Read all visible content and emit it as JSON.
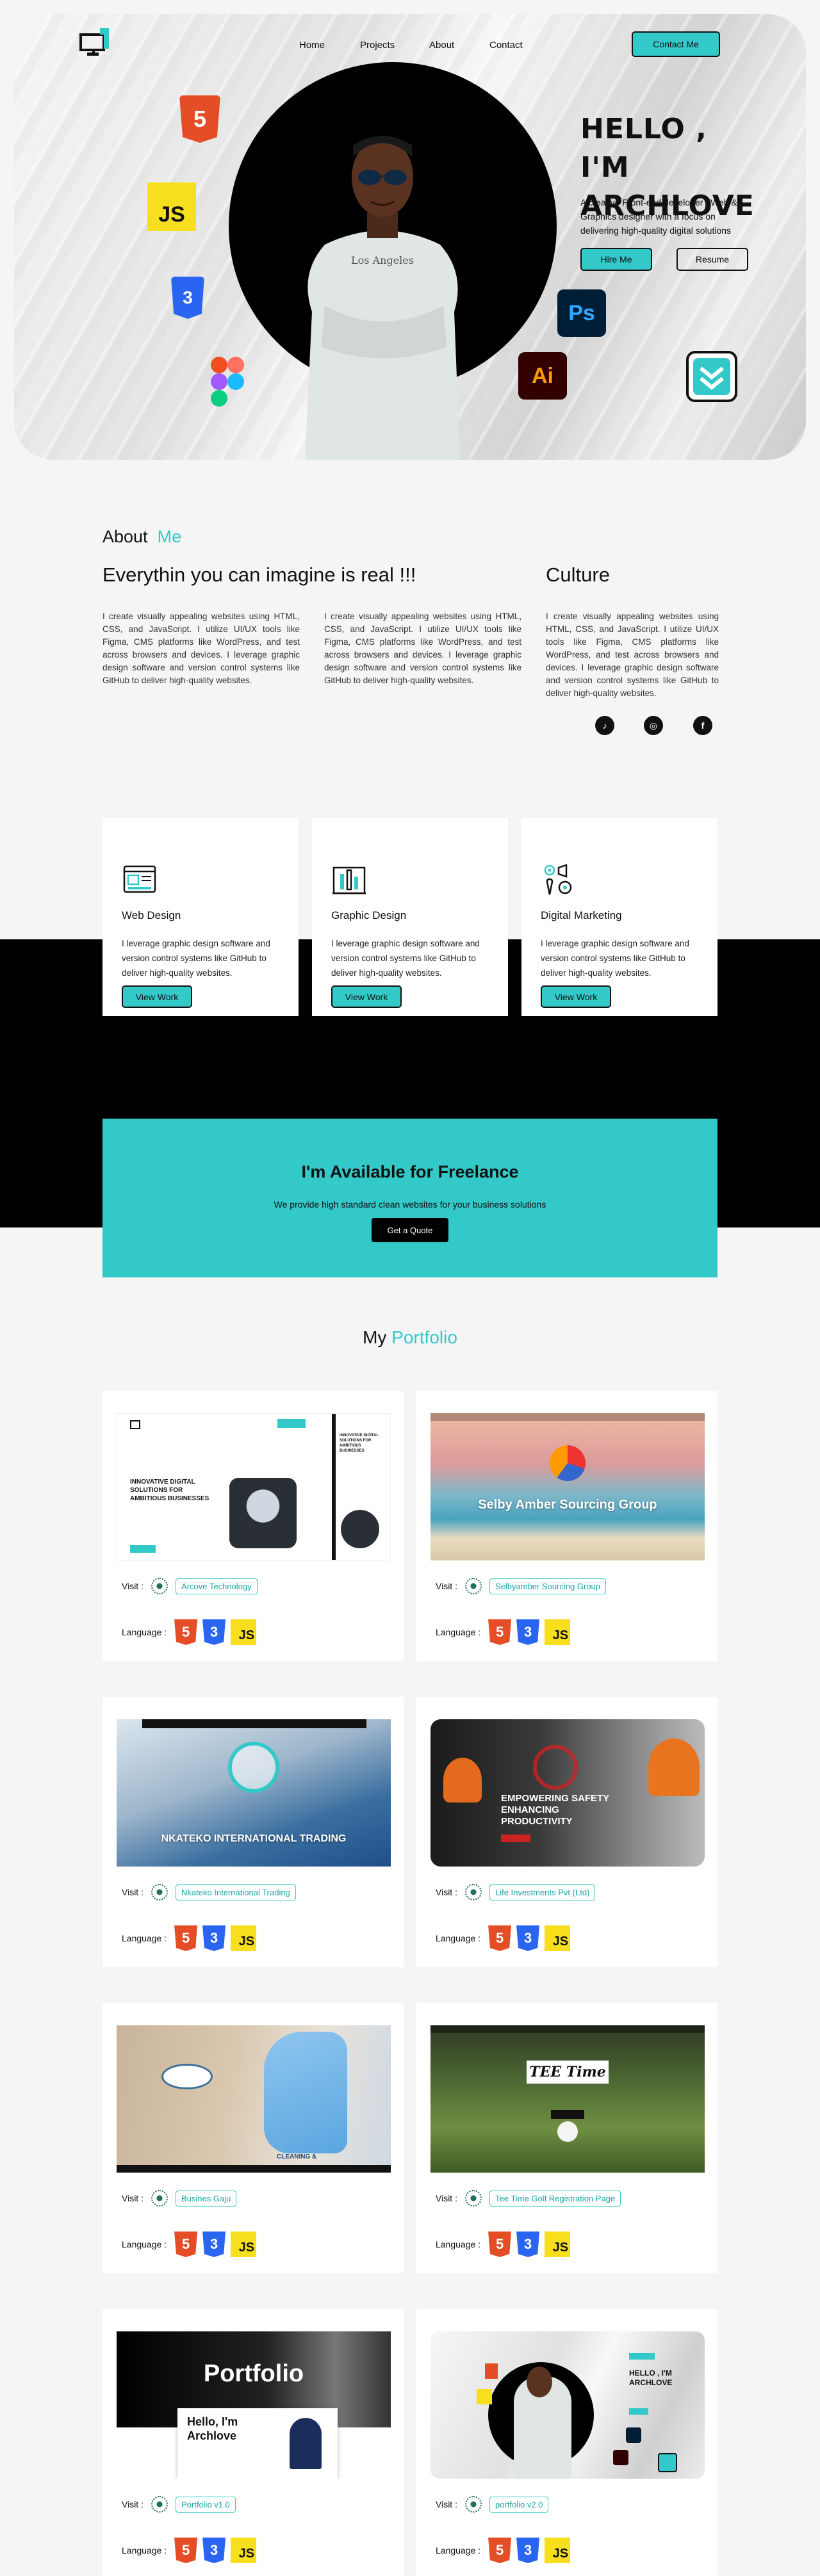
{
  "nav": {
    "items": [
      "Home",
      "Projects",
      "About",
      "Contact"
    ],
    "cta": "Contact Me"
  },
  "hero": {
    "line1": "HELLO ,",
    "line2": "I'M ARCHLOVE",
    "description": "A creative Front-end developer , Web & Graphics designer with a focus on delivering high-quality digital solutions",
    "primary_button": "Hire Me",
    "secondary_button": "Resume",
    "shirt_text": "Los Angeles",
    "tech_icons": {
      "html": "5",
      "js": "JS",
      "css": "3",
      "ps": "Ps",
      "ai": "Ai"
    }
  },
  "about": {
    "heading_prefix": "About",
    "heading_accent": "Me",
    "tagline": "Everythin you can imagine is real !!!",
    "culture_title": "Culture",
    "paragraph": "I create visually appealing websites using HTML, CSS, and JavaScript. I utilize UI/UX tools like Figma, CMS platforms like WordPress, and test across browsers and devices. I leverage graphic design software and version control systems like GitHub to deliver high-quality websites.",
    "social_icons": [
      "tiktok-icon",
      "instagram-icon",
      "facebook-icon"
    ]
  },
  "services": [
    {
      "title": "Web Design",
      "description": "I leverage graphic design software and version control systems like GitHub to deliver high-quality websites.",
      "button": "View Work"
    },
    {
      "title": "Graphic Design",
      "description": "I leverage graphic design software and version control systems like GitHub to deliver high-quality websites.",
      "button": "View Work"
    },
    {
      "title": "Digital Marketing",
      "description": "I leverage graphic design software and version control systems like GitHub to deliver high-quality websites.",
      "button": "View Work"
    }
  ],
  "freelance": {
    "title": "I'm Available for Freelance",
    "subtitle": "We provide high standard clean websites for your business solutions",
    "button": "Get a Quote"
  },
  "portfolio": {
    "heading_prefix": "My",
    "heading_accent": "Portfolio",
    "visit_label": "Visit :",
    "language_label": "Language :",
    "projects": [
      {
        "name": "Arcove Technology",
        "preview_title": "INNOVATIVE DIGITAL SOLUTIONS FOR AMBITIOUS BUSINESSES"
      },
      {
        "name": "Selbyamber Sourcing Group",
        "preview_title": "Selby Amber Sourcing Group"
      },
      {
        "name": "Nkateko International Trading",
        "preview_title": "NKATEKO INTERNATIONAL TRADING"
      },
      {
        "name": "Life Investments Pvt (Ltd)",
        "preview_title": "EMPOWERING SAFETY ENHANCING PRODUCTIVITY"
      },
      {
        "name": "Busines Gaju",
        "preview_title": "CLEANING &"
      },
      {
        "name": "Tee Time Golf Registration Page",
        "preview_title": "TEE Time"
      },
      {
        "name": "Portfolio v1.0",
        "preview_title": "Portfolio",
        "preview_sub": "Hello, I'm Archlove"
      },
      {
        "name": "portfolio v2.0",
        "preview_title": "HELLO , I'M ARCHLOVE"
      }
    ]
  },
  "colors": {
    "accent": "#33c9c9",
    "dark": "#111111",
    "html": "#e44d26",
    "css": "#2965f1",
    "js": "#f7df1e"
  }
}
